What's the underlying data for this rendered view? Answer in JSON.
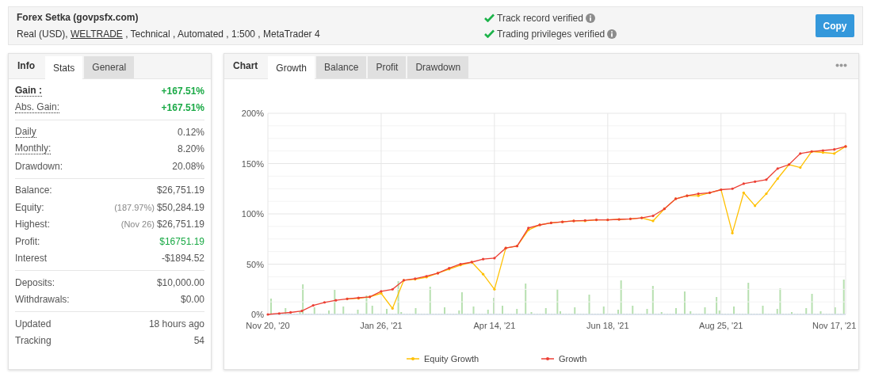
{
  "header": {
    "title": "Forex Setka (govpsfx.com)",
    "details_before": "Real (USD), ",
    "broker_link": "WELTRADE",
    "details_after": " , Technical , Automated , 1:500 , MetaTrader 4",
    "verifications": [
      {
        "label": "Track record verified",
        "checked": true
      },
      {
        "label": "Trading privileges verified",
        "checked": true
      }
    ],
    "button": "Copy"
  },
  "stats_panel": {
    "tabs": [
      {
        "label": "Info",
        "kind": "heading"
      },
      {
        "label": "Stats",
        "kind": "tab",
        "selected": true
      },
      {
        "label": "General",
        "kind": "tab",
        "selected": false
      }
    ],
    "sections": [
      [
        {
          "label": "Gain :",
          "value": "+167.51%",
          "bold": true,
          "dotted": true,
          "positive": true
        },
        {
          "label": "Abs. Gain:",
          "value": "+167.51%",
          "bold": false,
          "dotted": true,
          "positive": true
        }
      ],
      [
        {
          "label": "Daily",
          "value": "0.12%",
          "bold": false,
          "dotted": true,
          "positive": false
        },
        {
          "label": "Monthly:",
          "value": "8.20%",
          "bold": false,
          "dotted": true,
          "positive": false
        },
        {
          "label": "Drawdown:",
          "value": "20.08%",
          "bold": false,
          "dotted": false,
          "positive": false
        }
      ],
      [
        {
          "label": "Balance:",
          "value": "$26,751.19",
          "bold": false,
          "dotted": false,
          "positive": false
        },
        {
          "label": "Equity:",
          "note": "(187.97%)",
          "value": "$50,284.19",
          "bold": false,
          "dotted": false,
          "positive": false
        },
        {
          "label": "Highest:",
          "note": "(Nov 26)",
          "value": "$26,751.19",
          "bold": false,
          "dotted": false,
          "positive": false
        },
        {
          "label": "Profit:",
          "value": "$16751.19",
          "bold": false,
          "dotted": false,
          "positive": true
        },
        {
          "label": "Interest",
          "value": "-$1894.52",
          "bold": false,
          "dotted": false,
          "positive": false
        }
      ],
      [
        {
          "label": "Deposits:",
          "value": "$10,000.00",
          "bold": false,
          "dotted": false,
          "positive": false
        },
        {
          "label": "Withdrawals:",
          "value": "$0.00",
          "bold": false,
          "dotted": false,
          "positive": false
        }
      ],
      [
        {
          "label": "Updated",
          "value": "18 hours ago",
          "bold": false,
          "dotted": false,
          "positive": false
        },
        {
          "label": "Tracking",
          "value": "54",
          "bold": false,
          "dotted": false,
          "positive": false
        }
      ]
    ]
  },
  "chart_panel": {
    "tabs": [
      {
        "label": "Chart",
        "kind": "heading"
      },
      {
        "label": "Growth",
        "kind": "tab",
        "selected": true
      },
      {
        "label": "Balance",
        "kind": "tab",
        "selected": false
      },
      {
        "label": "Profit",
        "kind": "tab",
        "selected": false
      },
      {
        "label": "Drawdown",
        "kind": "tab",
        "selected": false
      }
    ],
    "chart_data": {
      "type": "line",
      "categories": [
        "Nov 20, '20",
        null,
        null,
        null,
        null,
        null,
        null,
        null,
        null,
        null,
        "Jan 26, '21",
        null,
        null,
        null,
        null,
        null,
        null,
        null,
        null,
        null,
        "Apr 14, '21",
        null,
        null,
        null,
        null,
        null,
        null,
        null,
        null,
        null,
        "Jun 18, '21",
        null,
        null,
        null,
        null,
        null,
        null,
        null,
        null,
        null,
        "Aug 25, '21",
        null,
        null,
        null,
        null,
        null,
        null,
        null,
        null,
        null,
        "Nov 17, '21",
        null
      ],
      "series": [
        {
          "name": "Equity Growth",
          "color": "#ffc000",
          "values": [
            null,
            null,
            null,
            null,
            null,
            null,
            null,
            15.5,
            16,
            17.5,
            21,
            6,
            34,
            35,
            37,
            41,
            45,
            49,
            52,
            40,
            25,
            66,
            68,
            84,
            89,
            91,
            92,
            93,
            93,
            94,
            94,
            94.5,
            95,
            96,
            93,
            105,
            115,
            118,
            118,
            121,
            124,
            81,
            121,
            108,
            120,
            135,
            149,
            146,
            162,
            161,
            160,
            167
          ]
        },
        {
          "name": "Growth",
          "color": "#ec3f34",
          "values": [
            0,
            1,
            2,
            3.5,
            9,
            12,
            14,
            15.5,
            16.5,
            17.5,
            23,
            25,
            34,
            35.5,
            38,
            41,
            46,
            50,
            52,
            55,
            56,
            66,
            68,
            86,
            89,
            91,
            92,
            93,
            93.5,
            94,
            94,
            94.5,
            95,
            96,
            98,
            105,
            115,
            118,
            120,
            121,
            124,
            125,
            130,
            132,
            134,
            145,
            149,
            160,
            162,
            163,
            164,
            167
          ]
        }
      ],
      "ylim": [
        0,
        200
      ],
      "grid": true,
      "legend": "bottom",
      "yticks": [
        {
          "value": 0,
          "label": "0%"
        },
        {
          "value": 50,
          "label": "50%"
        },
        {
          "value": 100,
          "label": "100%"
        },
        {
          "value": 150,
          "label": "150%"
        },
        {
          "value": 200,
          "label": "200%"
        }
      ]
    }
  }
}
